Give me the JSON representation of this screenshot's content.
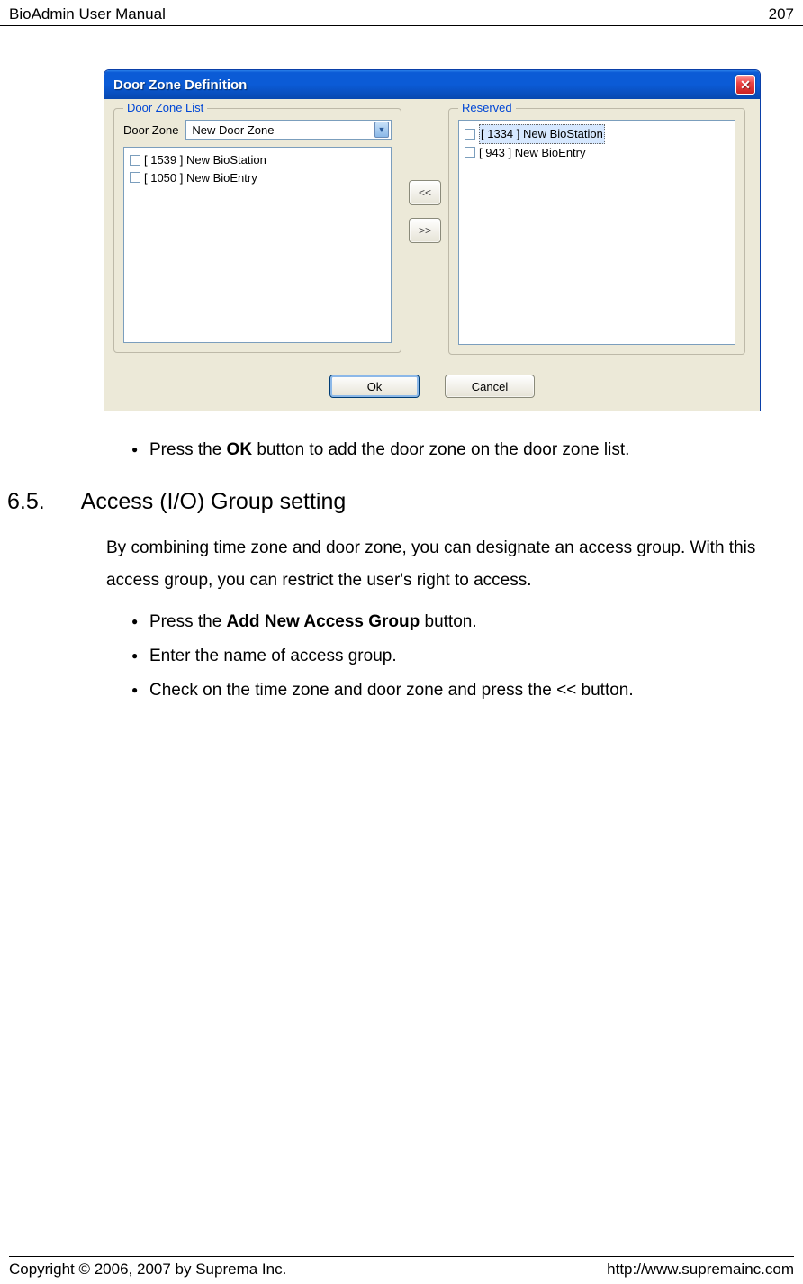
{
  "header": {
    "left": "BioAdmin User Manual",
    "right": "207"
  },
  "dialog": {
    "title": "Door Zone Definition",
    "close": "✕",
    "left_legend": "Door Zone List",
    "right_legend": "Reserved",
    "door_zone_label": "Door Zone",
    "door_zone_value": "New Door Zone",
    "left_items": [
      "[ 1539 ] New BioStation",
      "[ 1050 ] New BioEntry"
    ],
    "right_items": [
      "[ 1334 ] New BioStation",
      "[ 943 ] New BioEntry"
    ],
    "btn_left": "<<",
    "btn_right": ">>",
    "ok": "Ok",
    "cancel": "Cancel"
  },
  "body": {
    "bullet1_a": "Press the ",
    "bullet1_b": "OK",
    "bullet1_c": " button to add the door zone on the door zone list.",
    "section_num": "6.5.",
    "section_title": "Access (I/O) Group setting",
    "para": "By combining time zone and door zone, you can designate an access group. With this access group, you can restrict the user's right to access.",
    "bullet2_a": "Press the ",
    "bullet2_b": "Add New Access Group",
    "bullet2_c": " button.",
    "bullet3": "Enter the name of access group.",
    "bullet4": "Check on the time zone and door zone and press the << button."
  },
  "footer": {
    "left": "Copyright © 2006, 2007 by Suprema Inc.",
    "right": "http://www.supremainc.com"
  }
}
